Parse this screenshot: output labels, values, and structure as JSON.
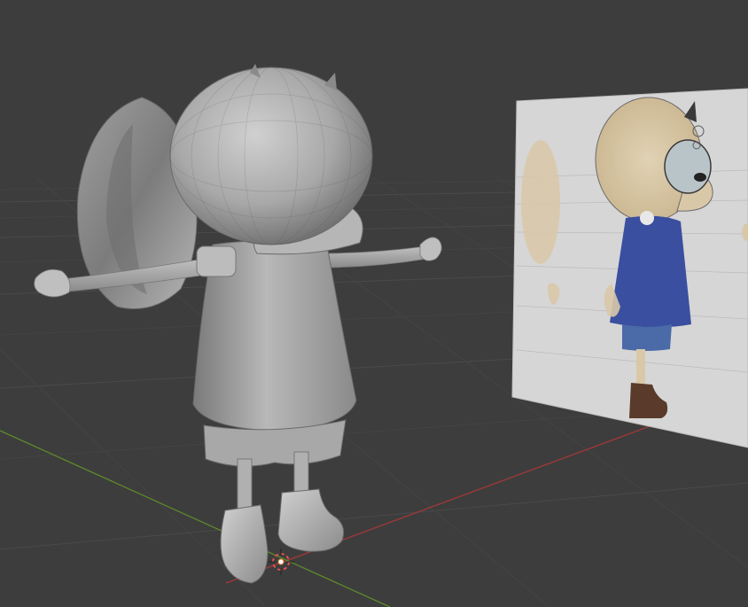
{
  "viewport": {
    "background_color": "#3d3d3d",
    "grid_line_color": "#4a4a4a",
    "grid_line_minor_color": "#444444",
    "x_axis_color": "#b23a3a",
    "y_axis_color": "#6a9a2a"
  },
  "scene": {
    "character_model": {
      "material_color": "#9a9a9a",
      "highlight_color": "#c4c4c4",
      "shadow_color": "#6e6e6e"
    },
    "reference_image_plane": {
      "background_color": "#d8d8d8",
      "skin_color": "#d9c8a8",
      "shirt_color": "#3a4fa0",
      "shorts_color": "#4a6aa8",
      "boot_color": "#5a3a2a",
      "line_color": "#3a3a3a"
    },
    "cursor_3d": {
      "icon": "3d-cursor-icon",
      "ring_color": "#e05050",
      "center_color": "#ffffff"
    }
  }
}
